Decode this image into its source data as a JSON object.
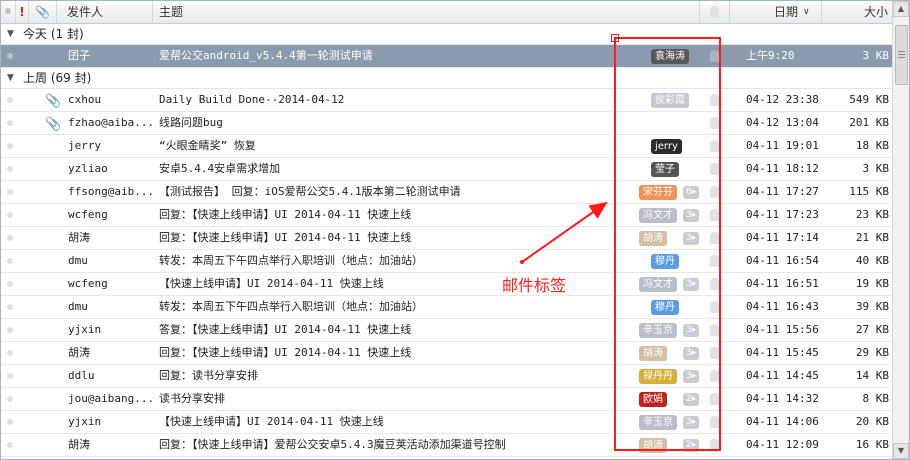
{
  "columns": {
    "sender": "发件人",
    "subject": "主题",
    "date": "日期",
    "size": "大小"
  },
  "colors": {
    "tag_gray": "#b9bfc8",
    "tag_black": "#2b2b2b",
    "tag_dark": "#555555",
    "tag_orange": "#f0935a",
    "tag_blue": "#5b9be6",
    "tag_gold": "#d6b13a",
    "tag_red": "#c2221f",
    "tag_beige": "#d1c0a2",
    "selected_row": "#8c9ab0",
    "annotation": "#ff1a1a"
  },
  "groups": [
    {
      "title": "今天 (1 封)",
      "rows": [
        {
          "sender": "囝子",
          "subject": "爱帮公交android_v5.4.4第一轮测试申请",
          "tag": "袁海涛",
          "tag_color": "#575757",
          "count": "",
          "date": "上午9:20",
          "size": "3 KB",
          "clip": false,
          "selected": true
        }
      ]
    },
    {
      "title": "上周 (69 封)",
      "rows": [
        {
          "sender": "cxhou",
          "subject": "Daily Build Done--2014-04-12",
          "tag": "侯彩霞",
          "tag_color": "#c3c7ce",
          "count": "",
          "date": "04-12 23:38",
          "size": "549 KB",
          "clip": true
        },
        {
          "sender": "fzhao@aiba...",
          "subject": "线路问题bug",
          "tag": "",
          "tag_color": "",
          "count": "",
          "date": "04-12 13:04",
          "size": "201 KB",
          "clip": true
        },
        {
          "sender": "jerry",
          "subject": "“火眼金睛奖” 恢复",
          "tag": "jerry",
          "tag_color": "#2b2b2b",
          "count": "",
          "date": "04-11 19:01",
          "size": "18 KB",
          "clip": false
        },
        {
          "sender": "yzliao",
          "subject": "安卓5.4.4安卓需求增加",
          "tag": "莹子",
          "tag_color": "#555555",
          "count": "",
          "date": "04-11 18:12",
          "size": "3 KB",
          "clip": false
        },
        {
          "sender": "ffsong@aib...",
          "subject": "【测试报告】  回复：iOS爱帮公交5.4.1版本第二轮测试申请",
          "tag": "宋芬芬",
          "tag_color": "#f0935a",
          "count": "6",
          "date": "04-11 17:27",
          "size": "115 KB",
          "clip": false
        },
        {
          "sender": "wcfeng",
          "subject": "回复：【快速上线申请】UI 2014-04-11 快速上线",
          "tag": "冯文才",
          "tag_color": "#b9bfc8",
          "count": "3",
          "date": "04-11 17:23",
          "size": "23 KB",
          "clip": false
        },
        {
          "sender": "胡涛",
          "subject": "回复：【快速上线申请】UI 2014-04-11 快速上线",
          "tag": "胡涛",
          "tag_color": "#d1c0a2",
          "count": "3",
          "date": "04-11 17:14",
          "size": "21 KB",
          "clip": false
        },
        {
          "sender": "dmu",
          "subject": "转发：本周五下午四点举行入职培训（地点：加油站）",
          "tag": "穆丹",
          "tag_color": "#5b9be6",
          "count": "",
          "date": "04-11 16:54",
          "size": "40 KB",
          "clip": false
        },
        {
          "sender": "wcfeng",
          "subject": "【快速上线申请】UI 2014-04-11 快速上线",
          "tag": "冯文才",
          "tag_color": "#b9bfc8",
          "count": "3",
          "date": "04-11 16:51",
          "size": "19 KB",
          "clip": false
        },
        {
          "sender": "dmu",
          "subject": "转发：本周五下午四点举行入职培训（地点：加油站）",
          "tag": "穆丹",
          "tag_color": "#5b9be6",
          "count": "",
          "date": "04-11 16:43",
          "size": "39 KB",
          "clip": false
        },
        {
          "sender": "yjxin",
          "subject": "答复：【快速上线申请】UI 2014-04-11 快速上线",
          "tag": "辛玉京",
          "tag_color": "#b9bfc8",
          "count": "3",
          "date": "04-11 15:56",
          "size": "27 KB",
          "clip": false
        },
        {
          "sender": "胡涛",
          "subject": "回复：【快速上线申请】UI 2014-04-11 快速上线",
          "tag": "胡涛",
          "tag_color": "#d1c0a2",
          "count": "3",
          "date": "04-11 15:45",
          "size": "29 KB",
          "clip": false
        },
        {
          "sender": "ddlu",
          "subject": "回复：读书分享安排",
          "tag": "禄丹丹",
          "tag_color": "#d6b13a",
          "count": "3",
          "date": "04-11 14:45",
          "size": "14 KB",
          "clip": false
        },
        {
          "sender": "jou@aibang...",
          "subject": "读书分享安排",
          "tag": "欧娟",
          "tag_color": "#c2221f",
          "count": "2",
          "date": "04-11 14:32",
          "size": "8 KB",
          "clip": false
        },
        {
          "sender": "yjxin",
          "subject": "【快速上线申请】UI 2014-04-11 快速上线",
          "tag": "辛玉京",
          "tag_color": "#b9bfc8",
          "count": "3",
          "date": "04-11 14:06",
          "size": "20 KB",
          "clip": false
        },
        {
          "sender": "胡涛",
          "subject": "回复：【快速上线申请】爱帮公交安卓5.4.3魔豆荚活动添加渠道号控制",
          "tag": "胡涛",
          "tag_color": "#d1c0a2",
          "count": "2",
          "date": "04-11 12:09",
          "size": "16 KB",
          "clip": false
        }
      ]
    }
  ],
  "annotation": "邮件标签"
}
